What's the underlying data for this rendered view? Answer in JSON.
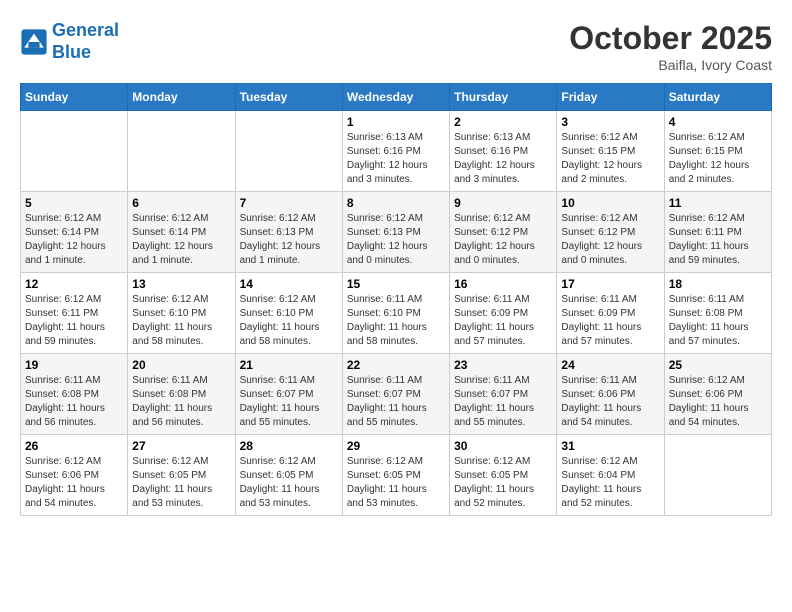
{
  "header": {
    "logo_line1": "General",
    "logo_line2": "Blue",
    "month": "October 2025",
    "location": "Baifla, Ivory Coast"
  },
  "weekdays": [
    "Sunday",
    "Monday",
    "Tuesday",
    "Wednesday",
    "Thursday",
    "Friday",
    "Saturday"
  ],
  "weeks": [
    [
      {
        "day": "",
        "info": ""
      },
      {
        "day": "",
        "info": ""
      },
      {
        "day": "",
        "info": ""
      },
      {
        "day": "1",
        "info": "Sunrise: 6:13 AM\nSunset: 6:16 PM\nDaylight: 12 hours\nand 3 minutes."
      },
      {
        "day": "2",
        "info": "Sunrise: 6:13 AM\nSunset: 6:16 PM\nDaylight: 12 hours\nand 3 minutes."
      },
      {
        "day": "3",
        "info": "Sunrise: 6:12 AM\nSunset: 6:15 PM\nDaylight: 12 hours\nand 2 minutes."
      },
      {
        "day": "4",
        "info": "Sunrise: 6:12 AM\nSunset: 6:15 PM\nDaylight: 12 hours\nand 2 minutes."
      }
    ],
    [
      {
        "day": "5",
        "info": "Sunrise: 6:12 AM\nSunset: 6:14 PM\nDaylight: 12 hours\nand 1 minute."
      },
      {
        "day": "6",
        "info": "Sunrise: 6:12 AM\nSunset: 6:14 PM\nDaylight: 12 hours\nand 1 minute."
      },
      {
        "day": "7",
        "info": "Sunrise: 6:12 AM\nSunset: 6:13 PM\nDaylight: 12 hours\nand 1 minute."
      },
      {
        "day": "8",
        "info": "Sunrise: 6:12 AM\nSunset: 6:13 PM\nDaylight: 12 hours\nand 0 minutes."
      },
      {
        "day": "9",
        "info": "Sunrise: 6:12 AM\nSunset: 6:12 PM\nDaylight: 12 hours\nand 0 minutes."
      },
      {
        "day": "10",
        "info": "Sunrise: 6:12 AM\nSunset: 6:12 PM\nDaylight: 12 hours\nand 0 minutes."
      },
      {
        "day": "11",
        "info": "Sunrise: 6:12 AM\nSunset: 6:11 PM\nDaylight: 11 hours\nand 59 minutes."
      }
    ],
    [
      {
        "day": "12",
        "info": "Sunrise: 6:12 AM\nSunset: 6:11 PM\nDaylight: 11 hours\nand 59 minutes."
      },
      {
        "day": "13",
        "info": "Sunrise: 6:12 AM\nSunset: 6:10 PM\nDaylight: 11 hours\nand 58 minutes."
      },
      {
        "day": "14",
        "info": "Sunrise: 6:12 AM\nSunset: 6:10 PM\nDaylight: 11 hours\nand 58 minutes."
      },
      {
        "day": "15",
        "info": "Sunrise: 6:11 AM\nSunset: 6:10 PM\nDaylight: 11 hours\nand 58 minutes."
      },
      {
        "day": "16",
        "info": "Sunrise: 6:11 AM\nSunset: 6:09 PM\nDaylight: 11 hours\nand 57 minutes."
      },
      {
        "day": "17",
        "info": "Sunrise: 6:11 AM\nSunset: 6:09 PM\nDaylight: 11 hours\nand 57 minutes."
      },
      {
        "day": "18",
        "info": "Sunrise: 6:11 AM\nSunset: 6:08 PM\nDaylight: 11 hours\nand 57 minutes."
      }
    ],
    [
      {
        "day": "19",
        "info": "Sunrise: 6:11 AM\nSunset: 6:08 PM\nDaylight: 11 hours\nand 56 minutes."
      },
      {
        "day": "20",
        "info": "Sunrise: 6:11 AM\nSunset: 6:08 PM\nDaylight: 11 hours\nand 56 minutes."
      },
      {
        "day": "21",
        "info": "Sunrise: 6:11 AM\nSunset: 6:07 PM\nDaylight: 11 hours\nand 55 minutes."
      },
      {
        "day": "22",
        "info": "Sunrise: 6:11 AM\nSunset: 6:07 PM\nDaylight: 11 hours\nand 55 minutes."
      },
      {
        "day": "23",
        "info": "Sunrise: 6:11 AM\nSunset: 6:07 PM\nDaylight: 11 hours\nand 55 minutes."
      },
      {
        "day": "24",
        "info": "Sunrise: 6:11 AM\nSunset: 6:06 PM\nDaylight: 11 hours\nand 54 minutes."
      },
      {
        "day": "25",
        "info": "Sunrise: 6:12 AM\nSunset: 6:06 PM\nDaylight: 11 hours\nand 54 minutes."
      }
    ],
    [
      {
        "day": "26",
        "info": "Sunrise: 6:12 AM\nSunset: 6:06 PM\nDaylight: 11 hours\nand 54 minutes."
      },
      {
        "day": "27",
        "info": "Sunrise: 6:12 AM\nSunset: 6:05 PM\nDaylight: 11 hours\nand 53 minutes."
      },
      {
        "day": "28",
        "info": "Sunrise: 6:12 AM\nSunset: 6:05 PM\nDaylight: 11 hours\nand 53 minutes."
      },
      {
        "day": "29",
        "info": "Sunrise: 6:12 AM\nSunset: 6:05 PM\nDaylight: 11 hours\nand 53 minutes."
      },
      {
        "day": "30",
        "info": "Sunrise: 6:12 AM\nSunset: 6:05 PM\nDaylight: 11 hours\nand 52 minutes."
      },
      {
        "day": "31",
        "info": "Sunrise: 6:12 AM\nSunset: 6:04 PM\nDaylight: 11 hours\nand 52 minutes."
      },
      {
        "day": "",
        "info": ""
      }
    ]
  ]
}
